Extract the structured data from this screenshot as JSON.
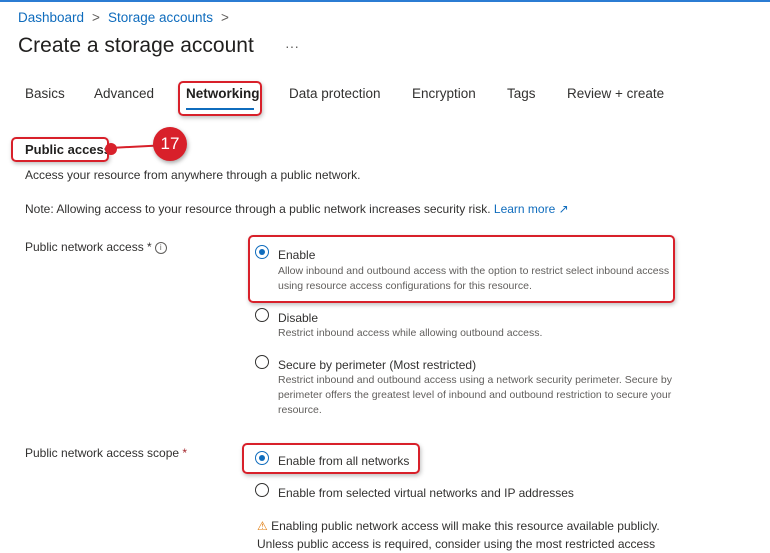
{
  "breadcrumb": {
    "items": [
      "Dashboard",
      "Storage accounts"
    ],
    "separator": ">"
  },
  "page": {
    "title": "Create a storage account",
    "more": "···"
  },
  "tabs": [
    {
      "label": "Basics"
    },
    {
      "label": "Advanced"
    },
    {
      "label": "Networking",
      "active": true
    },
    {
      "label": "Data protection"
    },
    {
      "label": "Encryption"
    },
    {
      "label": "Tags"
    },
    {
      "label": "Review + create"
    }
  ],
  "annotation": {
    "step": "17"
  },
  "public_access": {
    "heading": "Public access",
    "description": "Access your resource from anywhere through a public network.",
    "note": "Note: Allowing access to your resource through a public network increases security risk.",
    "learn_more": "Learn more",
    "learn_more_icon": "external-link-icon",
    "network_access": {
      "label": "Public network access *",
      "info_icon": "i",
      "options": [
        {
          "label": "Enable",
          "description": "Allow inbound and outbound access with the option to restrict select inbound access using resource access configurations for this resource.",
          "selected": true
        },
        {
          "label": "Disable",
          "description": "Restrict inbound access while allowing outbound access.",
          "selected": false
        },
        {
          "label": "Secure by perimeter (Most restricted)",
          "description": "Restrict inbound and outbound access using a network security perimeter. Secure by perimeter offers the greatest level of inbound and outbound restriction to secure your resource.",
          "selected": false
        }
      ]
    },
    "scope": {
      "label": "Public network access scope",
      "required": "*",
      "options": [
        {
          "label": "Enable from all networks",
          "selected": true
        },
        {
          "label": "Enable from selected virtual networks and IP addresses",
          "selected": false
        }
      ],
      "warning_icon": "⚠",
      "warning": "Enabling public network access will make this resource available publicly. Unless public access is required, consider using the most restricted access"
    }
  },
  "colors": {
    "accent": "#0f6cbd",
    "annotation": "#d8202a",
    "warning": "#e17c0e"
  }
}
